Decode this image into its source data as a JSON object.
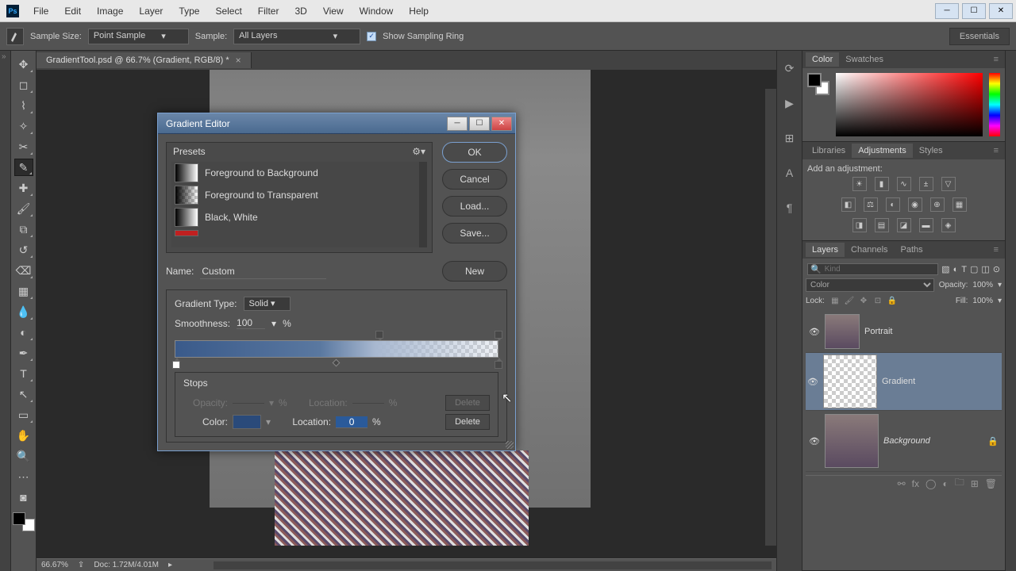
{
  "app_icon": "Ps",
  "menus": [
    "File",
    "Edit",
    "Image",
    "Layer",
    "Type",
    "Select",
    "Filter",
    "3D",
    "View",
    "Window",
    "Help"
  ],
  "options_bar": {
    "sample_size_label": "Sample Size:",
    "sample_size_value": "Point Sample",
    "sample_label": "Sample:",
    "sample_value": "All Layers",
    "show_sampling_ring": "Show Sampling Ring",
    "workspace": "Essentials"
  },
  "document": {
    "tab_title": "GradientTool.psd @ 66.7% (Gradient, RGB/8) *"
  },
  "status": {
    "zoom": "66.67%",
    "doc_info": "Doc: 1.72M/4.01M"
  },
  "panels": {
    "color_tabs": [
      "Color",
      "Swatches"
    ],
    "lib_tabs": [
      "Libraries",
      "Adjustments",
      "Styles"
    ],
    "adjustments_title": "Add an adjustment:",
    "layer_tabs": [
      "Layers",
      "Channels",
      "Paths"
    ],
    "layers": {
      "filter_placeholder": "Kind",
      "blend_mode": "Color",
      "opacity_label": "Opacity:",
      "opacity_value": "100%",
      "lock_label": "Lock:",
      "fill_label": "Fill:",
      "fill_value": "100%",
      "items": [
        {
          "name": "Portrait"
        },
        {
          "name": "Gradient"
        },
        {
          "name": "Background"
        }
      ]
    }
  },
  "dialog": {
    "title": "Gradient Editor",
    "presets_label": "Presets",
    "presets": [
      "Foreground to Background",
      "Foreground to Transparent",
      "Black, White"
    ],
    "buttons": {
      "ok": "OK",
      "cancel": "Cancel",
      "load": "Load...",
      "save": "Save...",
      "new": "New"
    },
    "name_label": "Name:",
    "name_value": "Custom",
    "gradient_type_label": "Gradient Type:",
    "gradient_type_value": "Solid",
    "smoothness_label": "Smoothness:",
    "smoothness_value": "100",
    "percent": "%",
    "stops": {
      "title": "Stops",
      "opacity_label": "Opacity:",
      "location_label": "Location:",
      "color_label": "Color:",
      "location_value": "0",
      "delete": "Delete"
    }
  }
}
